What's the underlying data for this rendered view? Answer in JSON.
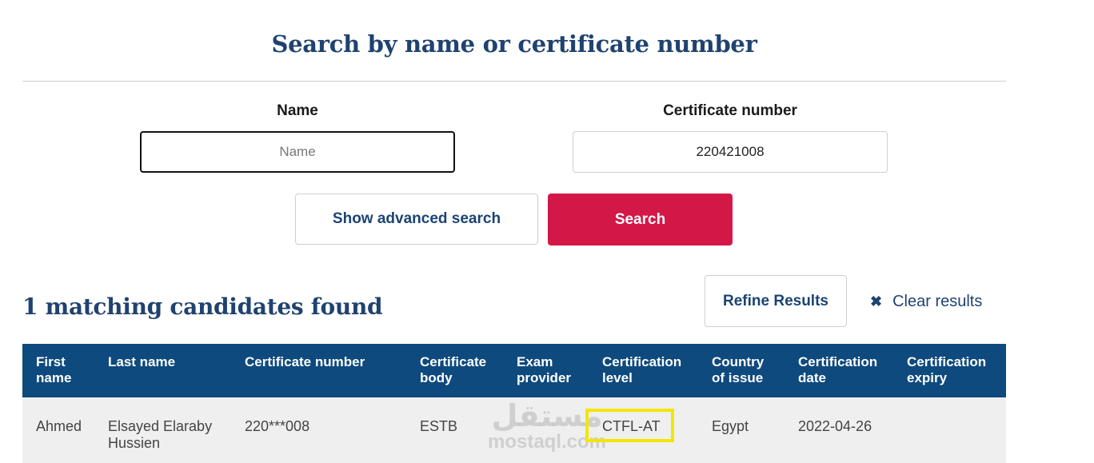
{
  "page": {
    "title": "Search by name or certificate number"
  },
  "search": {
    "name_label": "Name",
    "name_placeholder": "Name",
    "name_value": "",
    "cert_label": "Certificate number",
    "cert_value": "220421008",
    "advanced_label": "Show advanced search",
    "search_label": "Search"
  },
  "results": {
    "count_text": "1 matching candidates found",
    "refine_label": "Refine Results",
    "clear_icon": "close-icon",
    "clear_label": "Clear results"
  },
  "table": {
    "headers": [
      "First name",
      "Last name",
      "Certificate number",
      "Certificate body",
      "Exam provider",
      "Certification level",
      "Country of issue",
      "Certification date",
      "Certification expiry"
    ],
    "rows": [
      {
        "first_name": "Ahmed",
        "last_name": "Elsayed Elaraby Hussien",
        "certificate_number": "220***008",
        "certificate_body": "ESTB",
        "exam_provider": "",
        "certification_level": "CTFL-AT",
        "country_of_issue": "Egypt",
        "certification_date": "2022-04-26",
        "certification_expiry": ""
      }
    ]
  },
  "watermark": {
    "arabic": "مستقل",
    "latin": "mostaql.com"
  },
  "colors": {
    "heading": "#1f4270",
    "header_bg": "#0e4a7e",
    "search_button": "#d31848",
    "highlight": "#f3e600",
    "row_bg": "#efefef"
  }
}
